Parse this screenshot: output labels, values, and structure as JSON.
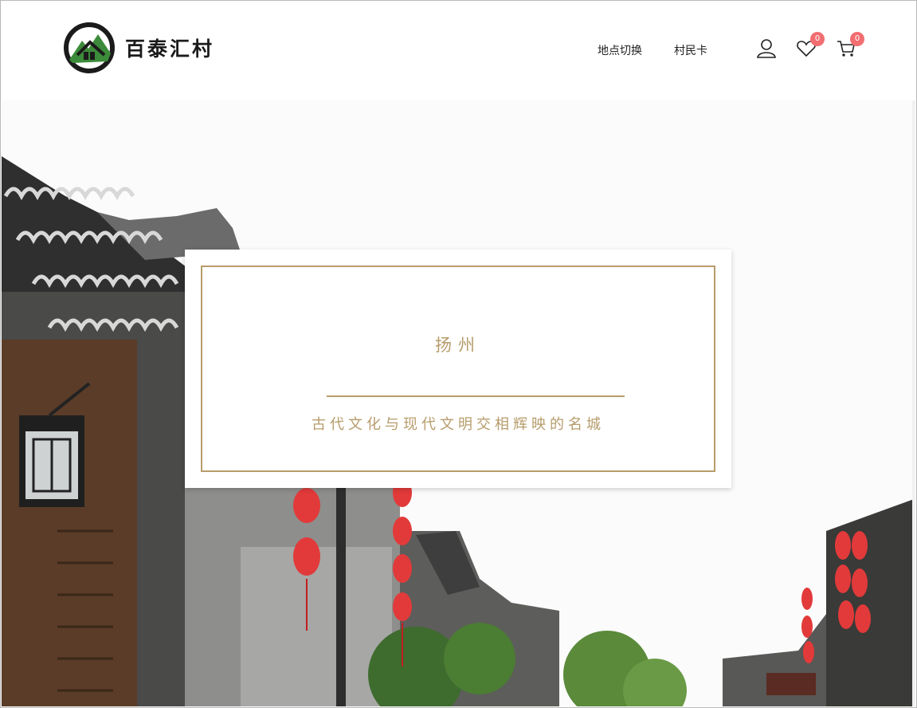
{
  "brand": {
    "name": "百泰汇村",
    "logo_icon": "house-mountain-logo-icon",
    "logo_color": "#1b1b1b",
    "logo_accent": "#3c8b3a"
  },
  "nav": {
    "items": [
      {
        "label": "地点切换"
      },
      {
        "label": "村民卡"
      }
    ]
  },
  "actions": {
    "account_icon": "user-icon",
    "wishlist_icon": "heart-icon",
    "wishlist_count": "0",
    "cart_icon": "cart-icon",
    "cart_count": "0",
    "badge_color": "#f26e71"
  },
  "hero": {
    "title": "扬州",
    "subtitle": "古代文化与现代文明交相辉映的名城",
    "accent_color": "#b79c6b"
  }
}
